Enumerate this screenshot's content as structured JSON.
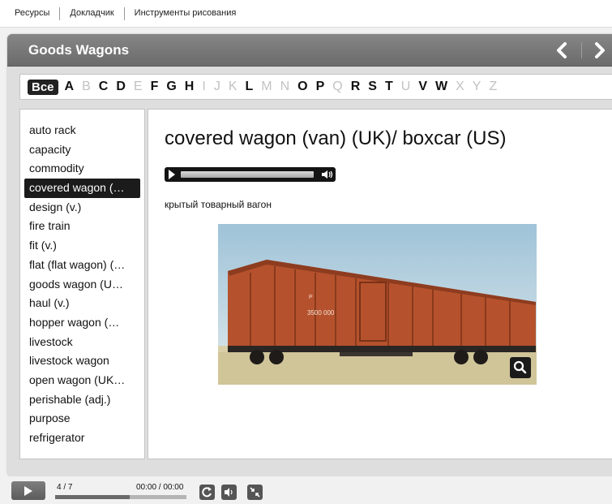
{
  "top_menu": {
    "items": [
      "Ресурсы",
      "Докладчик",
      "Инструменты рисования"
    ]
  },
  "panel": {
    "title": "Goods Wagons",
    "nav": {
      "prev_icon": "chevron-left-icon",
      "next_icon": "chevron-right-icon"
    }
  },
  "alphabet": {
    "all_label": "Все",
    "letters": [
      {
        "letter": "A",
        "enabled": true
      },
      {
        "letter": "B",
        "enabled": false
      },
      {
        "letter": "C",
        "enabled": true
      },
      {
        "letter": "D",
        "enabled": true
      },
      {
        "letter": "E",
        "enabled": false
      },
      {
        "letter": "F",
        "enabled": true
      },
      {
        "letter": "G",
        "enabled": true
      },
      {
        "letter": "H",
        "enabled": true
      },
      {
        "letter": "I",
        "enabled": false
      },
      {
        "letter": "J",
        "enabled": false
      },
      {
        "letter": "K",
        "enabled": false
      },
      {
        "letter": "L",
        "enabled": true
      },
      {
        "letter": "M",
        "enabled": false
      },
      {
        "letter": "N",
        "enabled": false
      },
      {
        "letter": "O",
        "enabled": true
      },
      {
        "letter": "P",
        "enabled": true
      },
      {
        "letter": "Q",
        "enabled": false
      },
      {
        "letter": "R",
        "enabled": true
      },
      {
        "letter": "S",
        "enabled": true
      },
      {
        "letter": "T",
        "enabled": true
      },
      {
        "letter": "U",
        "enabled": false
      },
      {
        "letter": "V",
        "enabled": true
      },
      {
        "letter": "W",
        "enabled": true
      },
      {
        "letter": "X",
        "enabled": false
      },
      {
        "letter": "Y",
        "enabled": false
      },
      {
        "letter": "Z",
        "enabled": false
      }
    ]
  },
  "terms": {
    "selected_index": 3,
    "items": [
      "auto rack",
      "capacity",
      "commodity",
      "covered wagon (…",
      "design (v.)",
      "fire train",
      "fit (v.)",
      "flat (flat wagon) (…",
      "goods wagon (U…",
      "haul (v.)",
      "hopper wagon (…",
      "livestock",
      "livestock wagon",
      "open wagon (UK…",
      "perishable (adj.)",
      "purpose",
      "refrigerator"
    ]
  },
  "entry": {
    "title": "covered wagon (van) (UK)/ boxcar (US)",
    "translation": "крытый товарный вагон",
    "image_text": {
      "car_marking": "3500 000",
      "plate": "Р"
    },
    "zoom_icon": "magnifier-icon"
  },
  "player": {
    "slide_counter": "4 / 7",
    "time": "00:00 / 00:00",
    "progress": 0.57,
    "controls": [
      "replay-icon",
      "volume-icon",
      "fullscreen-exit-icon"
    ]
  },
  "colors": {
    "header_bg": "#767676",
    "selected_bg": "#1b1b1b",
    "wagon": "#b5522d",
    "disabled_letter": "#c2c2c2"
  }
}
